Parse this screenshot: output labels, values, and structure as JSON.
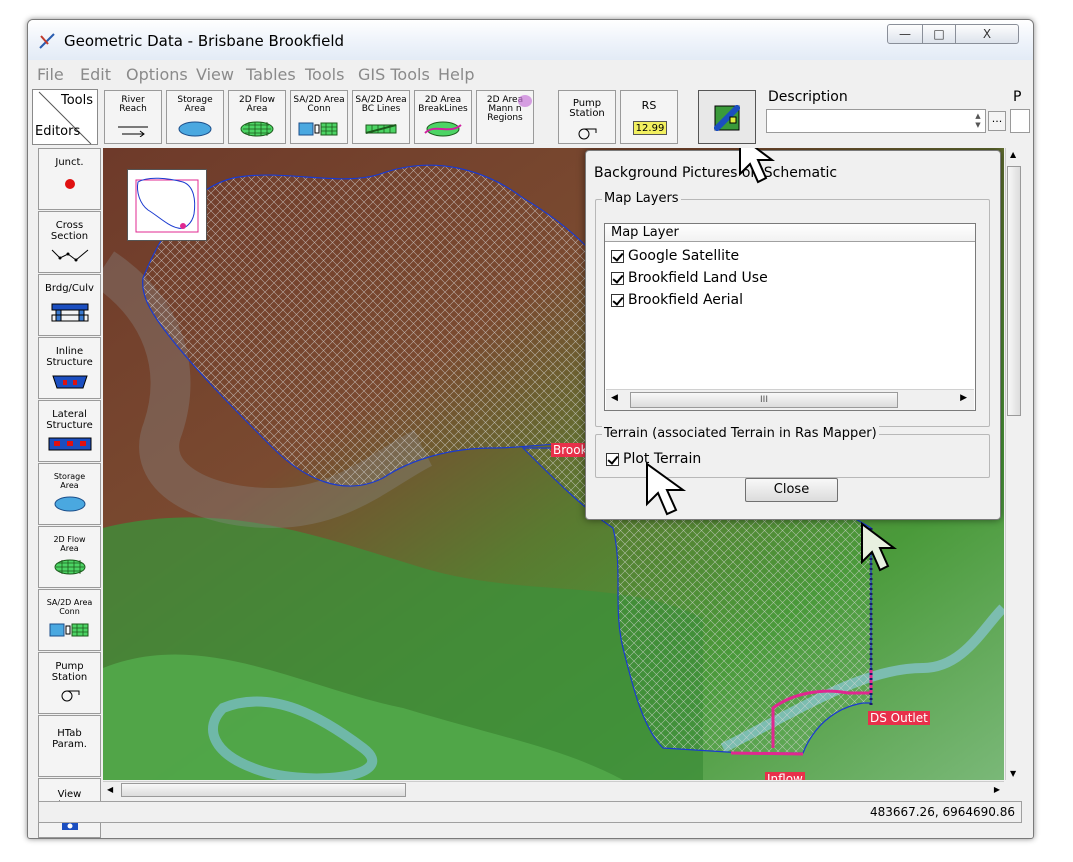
{
  "window": {
    "title": "Geometric Data - Brisbane Brookfield",
    "controls": {
      "minimize": "—",
      "maximize": "□",
      "close": "X"
    }
  },
  "menu": [
    "File",
    "Edit",
    "Options",
    "View",
    "Tables",
    "Tools",
    "GIS Tools",
    "Help"
  ],
  "toolbar": {
    "tools_label": "Tools",
    "editors_label": "Editors",
    "buttons": [
      {
        "label": "River\nReach"
      },
      {
        "label": "Storage\nArea"
      },
      {
        "label": "2D Flow\nArea"
      },
      {
        "label": "SA/2D Area\nConn"
      },
      {
        "label": "SA/2D Area\nBC Lines"
      },
      {
        "label": "2D Area\nBreakLines"
      },
      {
        "label": "2D Area\nMann n\nRegions"
      },
      {
        "label": "Pump\nStation"
      },
      {
        "label": "RS"
      }
    ],
    "rs_value": "12.99",
    "description_label": "Description",
    "description_value": "",
    "ellipsis": "...",
    "extra_label": "P"
  },
  "sidebar": [
    {
      "label": "Junct."
    },
    {
      "label": "Cross\nSection"
    },
    {
      "label": "Brdg/Culv"
    },
    {
      "label": "Inline\nStructure"
    },
    {
      "label": "Lateral\nStructure"
    },
    {
      "label": "Storage\nArea"
    },
    {
      "label": "2D Flow\nArea"
    },
    {
      "label": "SA/2D Area\nConn"
    },
    {
      "label": "Pump\nStation"
    },
    {
      "label": "HTab\nParam."
    },
    {
      "label": "View\nPicture"
    }
  ],
  "map": {
    "labels": {
      "brookfield": "Brookfield",
      "ds_outlet": "DS Outlet",
      "inflow": "Inflow"
    }
  },
  "dialog": {
    "title": "Background Pictures on Schematic",
    "map_layers_group": "Map Layers",
    "list_header": "Map Layer",
    "layers": [
      {
        "name": "Google Satellite",
        "checked": true
      },
      {
        "name": "Brookfield Land Use",
        "checked": true
      },
      {
        "name": "Brookfield Aerial",
        "checked": true
      }
    ],
    "hscroll_thumb": "III",
    "terrain_group": "Terrain (associated Terrain in Ras Mapper)",
    "plot_terrain": "Plot Terrain",
    "plot_terrain_checked": true,
    "close_label": "Close"
  },
  "status": {
    "coordinates": "483667.26, 6964690.86"
  }
}
